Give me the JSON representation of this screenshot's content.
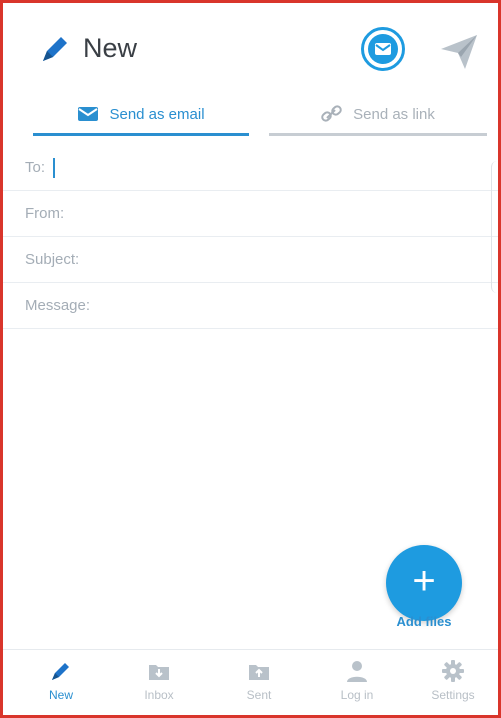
{
  "header": {
    "title": "New",
    "icons": {
      "compose": "pencil-icon",
      "email": "mail-icon",
      "send": "paper-plane-icon"
    }
  },
  "tabs": [
    {
      "label": "Send as email",
      "icon": "envelope-icon",
      "active": true
    },
    {
      "label": "Send as link",
      "icon": "link-icon",
      "active": false
    }
  ],
  "form": {
    "to_label": "To:",
    "to_value": "",
    "from_label": "From:",
    "subject_label": "Subject:",
    "message_label": "Message:"
  },
  "fab": {
    "label": "Add files",
    "icon": "plus-icon"
  },
  "bottom_nav": [
    {
      "label": "New",
      "icon": "pencil-icon",
      "active": true
    },
    {
      "label": "Inbox",
      "icon": "inbox-tray-icon",
      "active": false
    },
    {
      "label": "Sent",
      "icon": "sent-tray-icon",
      "active": false
    },
    {
      "label": "Log in",
      "icon": "user-icon",
      "active": false
    },
    {
      "label": "Settings",
      "icon": "gear-icon",
      "active": false
    }
  ],
  "colors": {
    "accent": "#1e9be0",
    "inactive": "#b8bfc6",
    "frame": "#d9352b"
  }
}
